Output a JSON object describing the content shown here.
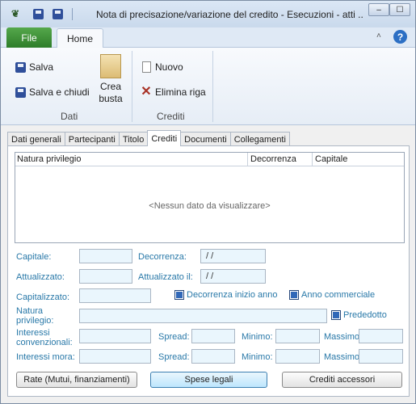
{
  "window": {
    "title": "Nota di precisazione/variazione del credito - Esecuzioni - atti ..."
  },
  "quick_access": {
    "emblem": "❦",
    "minimize": "‒",
    "maximize": "☐"
  },
  "ribbon": {
    "tabs": {
      "file": "File",
      "home": "Home"
    },
    "caret": "˄",
    "help": "?",
    "dati": {
      "label": "Dati",
      "salva": "Salva",
      "salva_e_chiudi": "Salva e chiudi",
      "crea_busta_1": "Crea",
      "crea_busta_2": "busta"
    },
    "crediti": {
      "label": "Crediti",
      "nuovo": "Nuovo",
      "elimina_riga": "Elimina riga"
    }
  },
  "tabs": [
    "Dati generali",
    "Partecipanti",
    "Titolo",
    "Crediti",
    "Documenti",
    "Collegamenti"
  ],
  "active_tab": "Crediti",
  "grid": {
    "columns": [
      "Natura privilegio",
      "Decorrenza",
      "Capitale"
    ],
    "empty_message": "<Nessun dato da visualizzare>"
  },
  "form": {
    "capitale": {
      "label": "Capitale:",
      "value": ""
    },
    "decorrenza": {
      "label": "Decorrenza:",
      "value": " /  /"
    },
    "attualizzato": {
      "label": "Attualizzato:",
      "value": ""
    },
    "attualizzato_il": {
      "label": "Attualizzato il:",
      "value": " /  /"
    },
    "capitalizzato": {
      "label": "Capitalizzato:",
      "value": ""
    },
    "decorrenza_inizio_anno": {
      "label": "Decorrenza inizio anno",
      "checked": true
    },
    "anno_commerciale": {
      "label": "Anno commerciale",
      "checked": true
    },
    "natura_privilegio": {
      "label_1": "Natura",
      "label_2": "privilegio:",
      "value": ""
    },
    "prededotto": {
      "label": "Prededotto",
      "checked": true
    },
    "interessi_convenzionali": {
      "label_1": "Interessi",
      "label_2": "convenzionali:",
      "value": ""
    },
    "interessi_mora": {
      "label": "Interessi mora:",
      "value": ""
    },
    "spread_label": "Spread:",
    "minimo_label": "Minimo:",
    "massimo_label": "Massimo"
  },
  "buttons": {
    "rate": "Rate (Mutui, finanziamenti)",
    "spese_legali": "Spese legali",
    "crediti_accessori": "Crediti accessori"
  },
  "colors": {
    "file_tab": "#2e7d2a",
    "label": "#2878a8",
    "field_bg": "#eaf6fd",
    "checkbox": "#3168b8"
  }
}
